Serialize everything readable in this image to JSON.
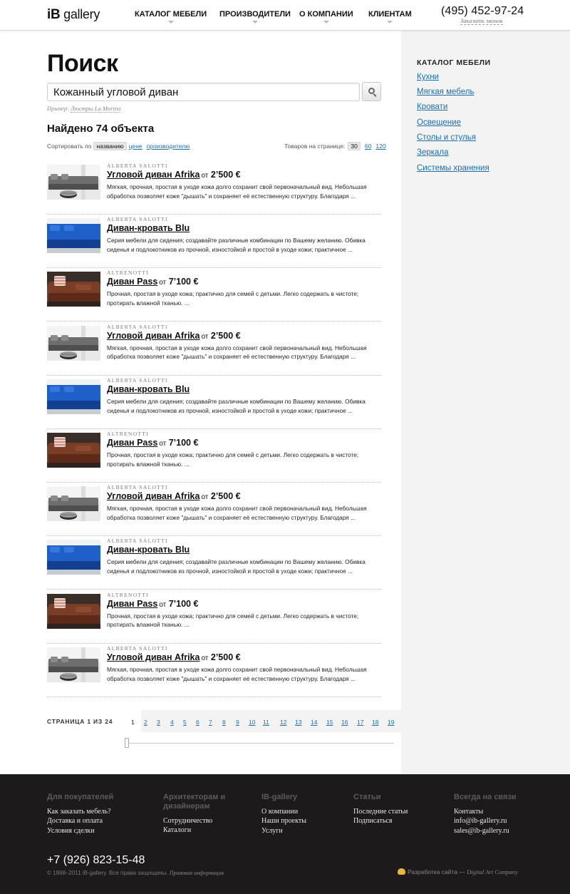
{
  "header": {
    "logo_ib": "iB",
    "logo_text": "gallery",
    "nav": [
      "КАТАЛОГ МЕБЕЛИ",
      "ПРОИЗВОДИТЕЛИ",
      "О КОМПАНИИ",
      "КЛИЕНТАМ"
    ],
    "phone": "(495) 452-97-24",
    "callback": "Заказать звонок"
  },
  "search": {
    "title": "Поиск",
    "value": "Кожанный угловой диван",
    "example_prefix": "Пример: ",
    "example_link": "Люстры La Murina",
    "found": "Найдено 74 объекта",
    "sort_label": "Сортировать по",
    "sort_active": "названию",
    "sort_price": "цене",
    "sort_maker": "производителю",
    "perpage_label": "Товаров на странице:",
    "perpage_active": "30",
    "perpage_60": "60",
    "perpage_120": "120"
  },
  "results": [
    {
      "brand": "ALBERTA SALOTTI",
      "name": "Угловой диван Afrika",
      "from": "от",
      "price": "2’500 €",
      "desc": "Мягкая, прочная, простая в уходе кожа долго сохранит свой первоначальный вид. Небольшая обработка позволяет коже \"дышать\" и сохраняет её естественную структуру. Благодаря ...",
      "img": "gray"
    },
    {
      "brand": "ALBERTA SALOTTI",
      "name": "Диван-кровать Blu",
      "from": "",
      "price": "",
      "desc": "Серия мебели для сидения; создавайте различные комбинации по Вашему желанию. Обивка сиденья и подлокотников из прочной, изностойкой и простой в уходе кожи; практичное ...",
      "img": "blue"
    },
    {
      "brand": "ALTRENOTTI",
      "name": "Диван Pass",
      "from": "от",
      "price": "7’100 €",
      "desc": "Прочная, простая в уходе кожа; практично для семей с детьми. Легко содержать в чистоте; протирать влажной тканью. ...",
      "img": "brown"
    },
    {
      "brand": "ALBERTA SALOTTI",
      "name": "Угловой диван Afrika",
      "from": "от",
      "price": "2’500 €",
      "desc": "Мягкая, прочная, простая в уходе кожа долго сохранит свой первоначальный вид. Небольшая обработка позволяет коже \"дышать\" и сохраняет её естественную структуру. Благодаря ...",
      "img": "gray"
    },
    {
      "brand": "ALBERTA SALOTTI",
      "name": "Диван-кровать Blu",
      "from": "",
      "price": "",
      "desc": "Серия мебели для сидения; создавайте различные комбинации по Вашему желанию. Обивка сиденья и подлокотников из прочной, изностойкой и простой в уходе кожи; практичное ...",
      "img": "blue"
    },
    {
      "brand": "ALTRENOTTI",
      "name": "Диван Pass",
      "from": "от",
      "price": "7’100 €",
      "desc": "Прочная, простая в уходе кожа; практично для семей с детьми. Легко содержать в чистоте; протирать влажной тканью. ...",
      "img": "brown"
    },
    {
      "brand": "ALBERTA SALOTTI",
      "name": "Угловой диван Afrika",
      "from": "от",
      "price": "2’500 €",
      "desc": "Мягкая, прочная, простая в уходе кожа долго сохранит свой первоначальный вид. Небольшая обработка позволяет коже \"дышать\" и сохраняет её естественную структуру. Благодаря ...",
      "img": "gray"
    },
    {
      "brand": "ALBERTA SALOTTI",
      "name": "Диван-кровать Blu",
      "from": "",
      "price": "",
      "desc": "Серия мебели для сидения; создавайте различные комбинации по Вашему желанию. Обивка сиденья и подлокотников из прочной, изностойкой и простой в уходе кожи; практичное ...",
      "img": "blue"
    },
    {
      "brand": "ALTRENOTTI",
      "name": "Диван Pass",
      "from": "от",
      "price": "7’100 €",
      "desc": "Прочная, простая в уходе кожа; практично для семей с детьми. Легко содержать в чистоте; протирать влажной тканью. ...",
      "img": "brown"
    },
    {
      "brand": "ALBERTA SALOTTI",
      "name": "Угловой диван Afrika",
      "from": "от",
      "price": "2’500 €",
      "desc": "Мягкая, прочная, простая в уходе кожа долго сохранит свой первоначальный вид. Небольшая обработка позволяет коже \"дышать\" и сохраняет её естественную структуру. Благодаря ...",
      "img": "gray"
    }
  ],
  "pagination": {
    "label": "СТРАНИЦА 1 ИЗ 24",
    "pages": [
      "1",
      "2",
      "3",
      "4",
      "5",
      "6",
      "7",
      "8",
      "9",
      "10",
      "11",
      "12",
      "13",
      "14",
      "15",
      "16",
      "17",
      "18",
      "19"
    ],
    "current": "1"
  },
  "sidebar": {
    "title": "КАТАЛОГ МЕБЕЛИ",
    "items": [
      "Кухни",
      "Мягкая мебель",
      "Кровати",
      "Освещение",
      "Столы и стулья",
      "Зеркала",
      "Системы хранения"
    ]
  },
  "footer": {
    "columns": [
      {
        "head": "Для покупателей",
        "links": [
          "Как заказать мебель?",
          "Доставка и оплата",
          "Условия сделки"
        ]
      },
      {
        "head": "Архитекторам и дизайнерам",
        "links": [
          "Сотрудничество",
          "Каталоги"
        ]
      },
      {
        "head": "IB-gallery",
        "links": [
          "О компании",
          "Наши проекты",
          "Услуги"
        ]
      },
      {
        "head": "Статьи",
        "links": [
          "Последние статьи",
          "Подписаться"
        ]
      },
      {
        "head": "Всегда на связи",
        "links": [
          "Контакты",
          "info@ib-gallery.ru",
          "sales@ib-gallery.ru"
        ]
      }
    ],
    "phone": "+7 (926) 823-15-48",
    "copyright": "© 1998–2011 iB-gallery. Все права защищены.",
    "legal": "Правовая информация",
    "dev_label": "Разработка сайта —",
    "dev_company": "Digital Art Company"
  },
  "colors": {
    "link": "#1a6fb0",
    "sidebar_bg": "#f3f3f3",
    "footer_bg": "#1c1a1a"
  }
}
